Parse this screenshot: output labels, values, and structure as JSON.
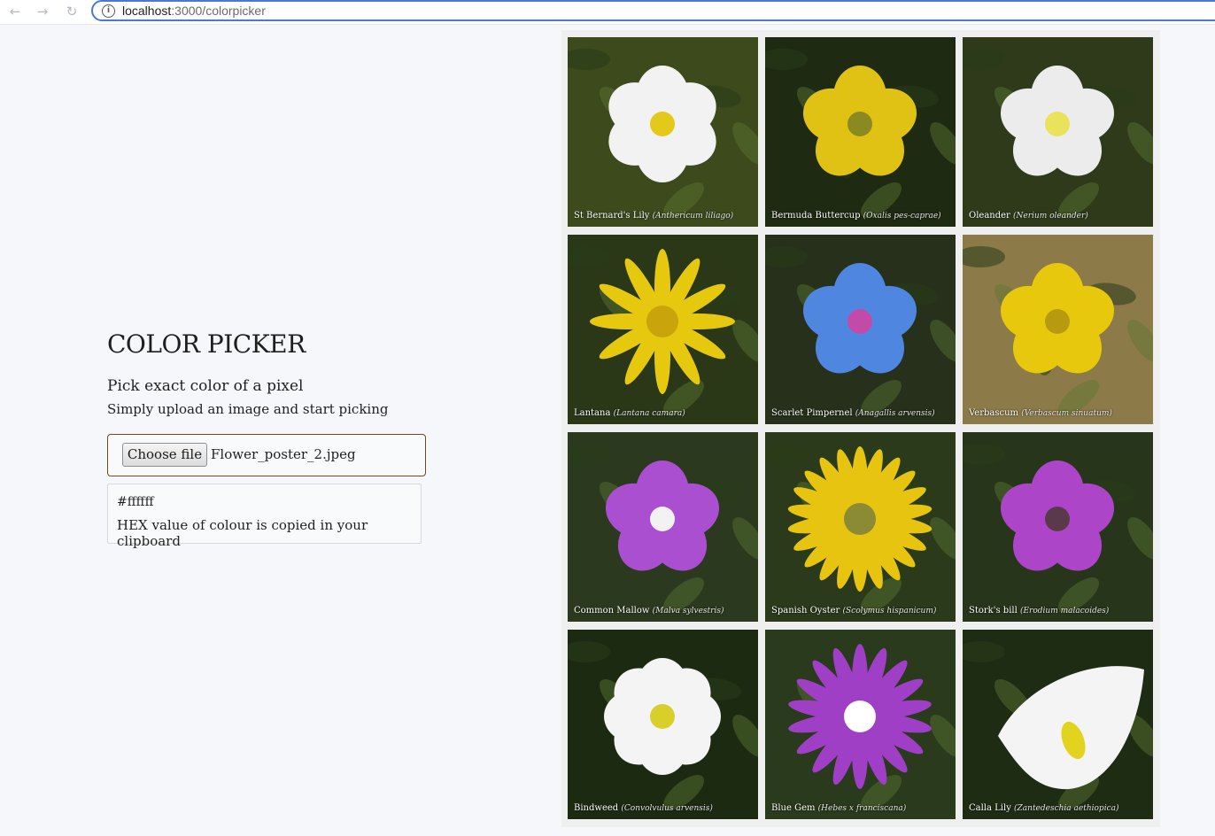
{
  "browser": {
    "url_host": "localhost",
    "url_path": ":3000/colorpicker"
  },
  "page": {
    "title": "COLOR PICKER",
    "subtitle": "Pick exact color of a pixel",
    "subtext": "Simply upload an image and start picking"
  },
  "upload": {
    "button_label": "Choose file",
    "file_name": "Flower_poster_2.jpeg"
  },
  "result": {
    "hex_value": "#ffffff",
    "message": "HEX value of colour is copied in your clipboard"
  },
  "poster": {
    "flowers": [
      {
        "name": "St Bernard's Lily",
        "latin": "(Anthericum liliago)",
        "petal_color": "#f2f2f2",
        "center_color": "#e2c91a",
        "background": "#3d4a1c"
      },
      {
        "name": "Bermuda Buttercup",
        "latin": "(Oxalis pes-caprae)",
        "petal_color": "#e0c214",
        "center_color": "#8a8a20",
        "background": "#1e2a12"
      },
      {
        "name": "Oleander",
        "latin": "(Nerium oleander)",
        "petal_color": "#ececec",
        "center_color": "#e8e35a",
        "background": "#2f3a1a"
      },
      {
        "name": "Lantana",
        "latin": "(Lantana camara)",
        "petal_color": "#e6c90e",
        "center_color": "#c9a40a",
        "background": "#2a3818"
      },
      {
        "name": "Scarlet Pimpernel",
        "latin": "(Anagallis arvensis)",
        "petal_color": "#4f86e0",
        "center_color": "#c44aa8",
        "background": "#26301a"
      },
      {
        "name": "Verbascum",
        "latin": "(Verbascum sinuatum)",
        "petal_color": "#e8c80c",
        "center_color": "#b79a10",
        "background": "#8c7a48"
      },
      {
        "name": "Common Mallow",
        "latin": "(Malva sylvestris)",
        "petal_color": "#a94fd0",
        "center_color": "#f2f2f2",
        "background": "#2b3a1e"
      },
      {
        "name": "Spanish Oyster",
        "latin": "(Scolymus hispanicum)",
        "petal_color": "#e6c40f",
        "center_color": "#8b8a35",
        "background": "#2a3a1a"
      },
      {
        "name": "Stork's bill",
        "latin": "(Erodium malacoides)",
        "petal_color": "#ad45c9",
        "center_color": "#5a3a4a",
        "background": "#27361a"
      },
      {
        "name": "Bindweed",
        "latin": "(Convolvulus arvensis)",
        "petal_color": "#f4f4f4",
        "center_color": "#d8cf2a",
        "background": "#1d2a12"
      },
      {
        "name": "Blue Gem",
        "latin": "(Hebes x franciscana)",
        "petal_color": "#9e3fc6",
        "center_color": "#ffffff",
        "background": "#2a3a1c"
      },
      {
        "name": "Calla Lily",
        "latin": "(Zantedeschia aethiopica)",
        "petal_color": "#f4f4f4",
        "center_color": "#e2d41e",
        "background": "#1f2c14"
      }
    ]
  }
}
